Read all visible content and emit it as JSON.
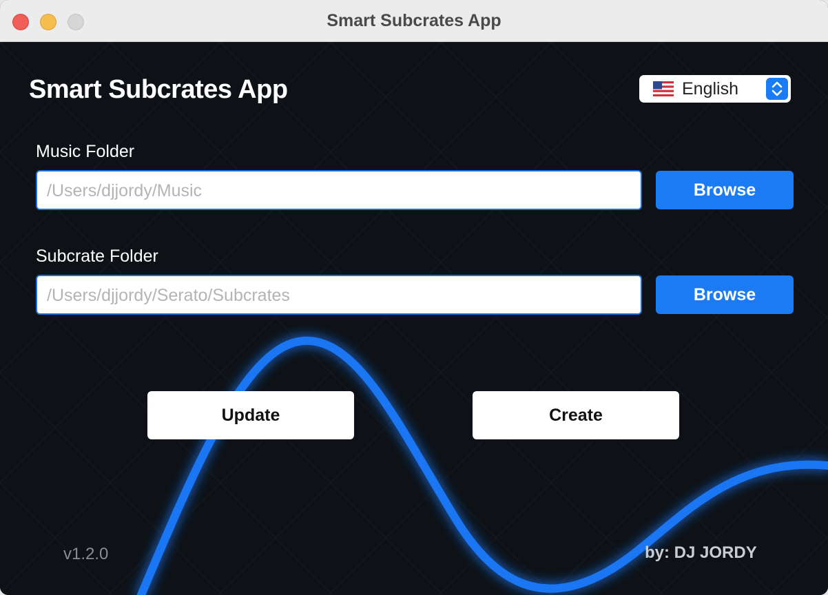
{
  "window": {
    "title": "Smart Subcrates App"
  },
  "header": {
    "app_title": "Smart Subcrates App",
    "language": {
      "flag_icon": "us-flag-icon",
      "selected": "English"
    }
  },
  "music_folder": {
    "label": "Music Folder",
    "placeholder": "/Users/djjordy/Music",
    "browse_label": "Browse"
  },
  "subcrate_folder": {
    "label": "Subcrate Folder",
    "placeholder": "/Users/djjordy/Serato/Subcrates",
    "browse_label": "Browse"
  },
  "actions": {
    "update_label": "Update",
    "create_label": "Create"
  },
  "footer": {
    "version": "v1.2.0",
    "credit": "by: DJ JORDY"
  },
  "colors": {
    "accent": "#1b7bf5",
    "background": "#0e1217",
    "wave": "#1a7cff"
  }
}
